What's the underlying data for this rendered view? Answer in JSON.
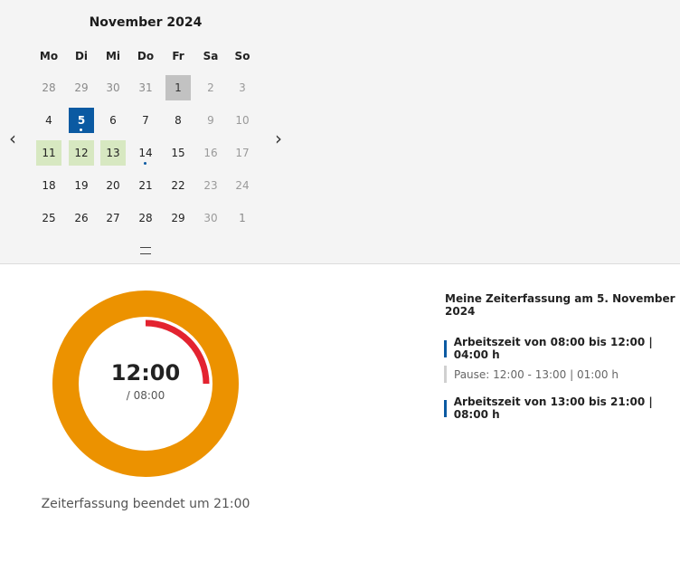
{
  "calendar": {
    "month_title": "November 2024",
    "weekdays": [
      "Mo",
      "Di",
      "Mi",
      "Do",
      "Fr",
      "Sa",
      "So"
    ],
    "prev_icon": "chevron-left-icon",
    "next_icon": "chevron-right-icon",
    "drag_handle_icon": "drag-handle-icon",
    "weeks": [
      [
        "28",
        "29",
        "30",
        "31",
        "1",
        "2",
        "3"
      ],
      [
        "4",
        "5",
        "6",
        "7",
        "8",
        "9",
        "10"
      ],
      [
        "11",
        "12",
        "13",
        "14",
        "15",
        "16",
        "17"
      ],
      [
        "18",
        "19",
        "20",
        "21",
        "22",
        "23",
        "24"
      ],
      [
        "25",
        "26",
        "27",
        "28",
        "29",
        "30",
        "1"
      ]
    ],
    "colors": {
      "selected": "#0b5aa2",
      "holiday": "#c2c2c2",
      "recorded": "#d7e8c1"
    }
  },
  "clock": {
    "time": "12:00",
    "target": "/ 08:00",
    "status": "Zeiterfassung beendet um 21:00",
    "overtime_fraction": 0.25,
    "colors": {
      "ring": "#ec9200",
      "overtime": "#e32330"
    }
  },
  "summary": {
    "title": "Meine Zeiterfassung am 5. November 2024",
    "entries": [
      {
        "type": "work",
        "label": "Arbeitszeit von 08:00 bis 12:00 | 04:00 h"
      },
      {
        "type": "pause",
        "label": "Pause: 12:00 - 13:00 | 01:00 h"
      },
      {
        "type": "work",
        "label": "Arbeitszeit von 13:00 bis 21:00 | 08:00 h"
      }
    ]
  }
}
